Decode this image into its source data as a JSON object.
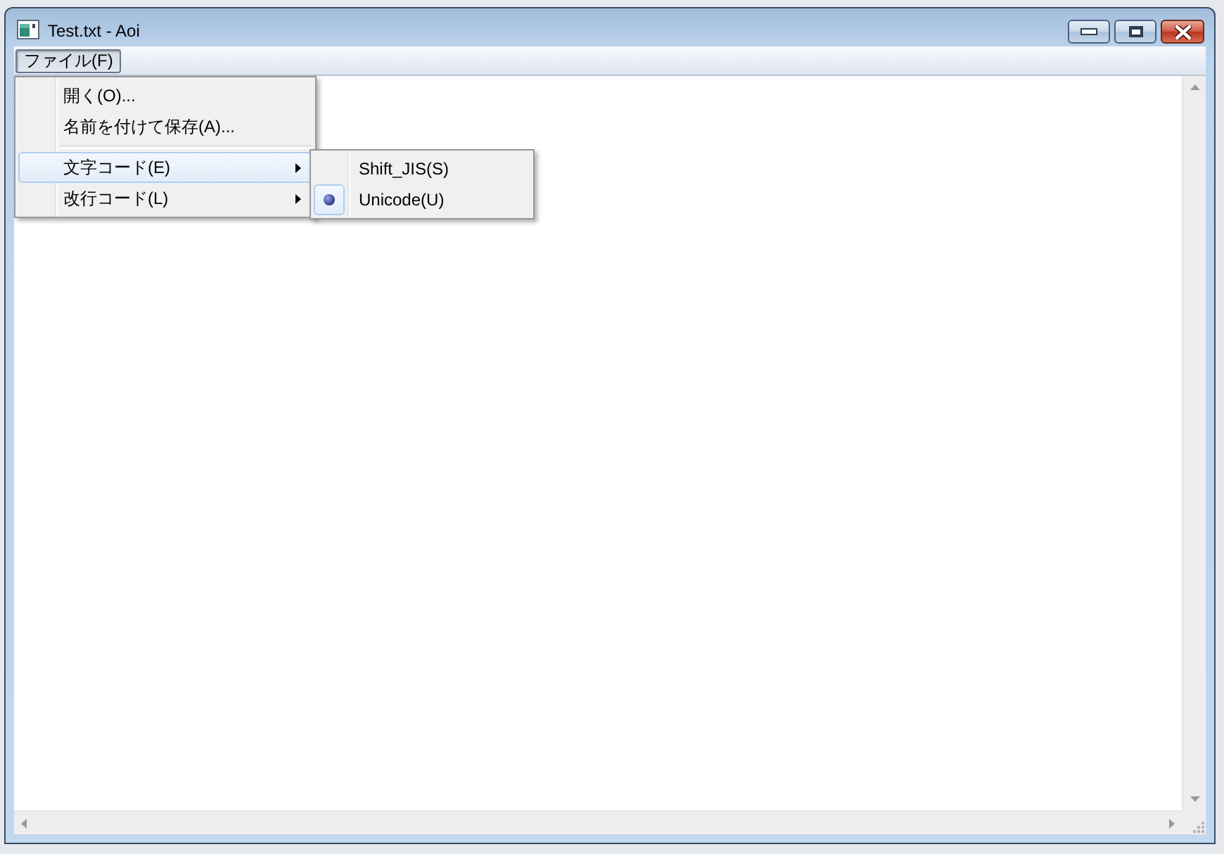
{
  "window": {
    "title": "Test.txt - Aoi"
  },
  "menu_bar": [
    {
      "label": "ファイル(F)",
      "selected": true
    }
  ],
  "file_menu": {
    "items": [
      {
        "kind": "item",
        "label": "開く(O)...",
        "selected": false
      },
      {
        "kind": "item",
        "label": "名前を付けて保存(A)...",
        "selected": false
      },
      {
        "kind": "separator"
      },
      {
        "kind": "submenu",
        "label": "文字コード(E)",
        "selected": true
      },
      {
        "kind": "submenu",
        "label": "改行コード(L)",
        "selected": false
      }
    ]
  },
  "encoding_submenu": {
    "items": [
      {
        "label": "Shift_JIS(S)",
        "selected": false
      },
      {
        "label": "Unicode(U)",
        "selected": true
      }
    ]
  }
}
